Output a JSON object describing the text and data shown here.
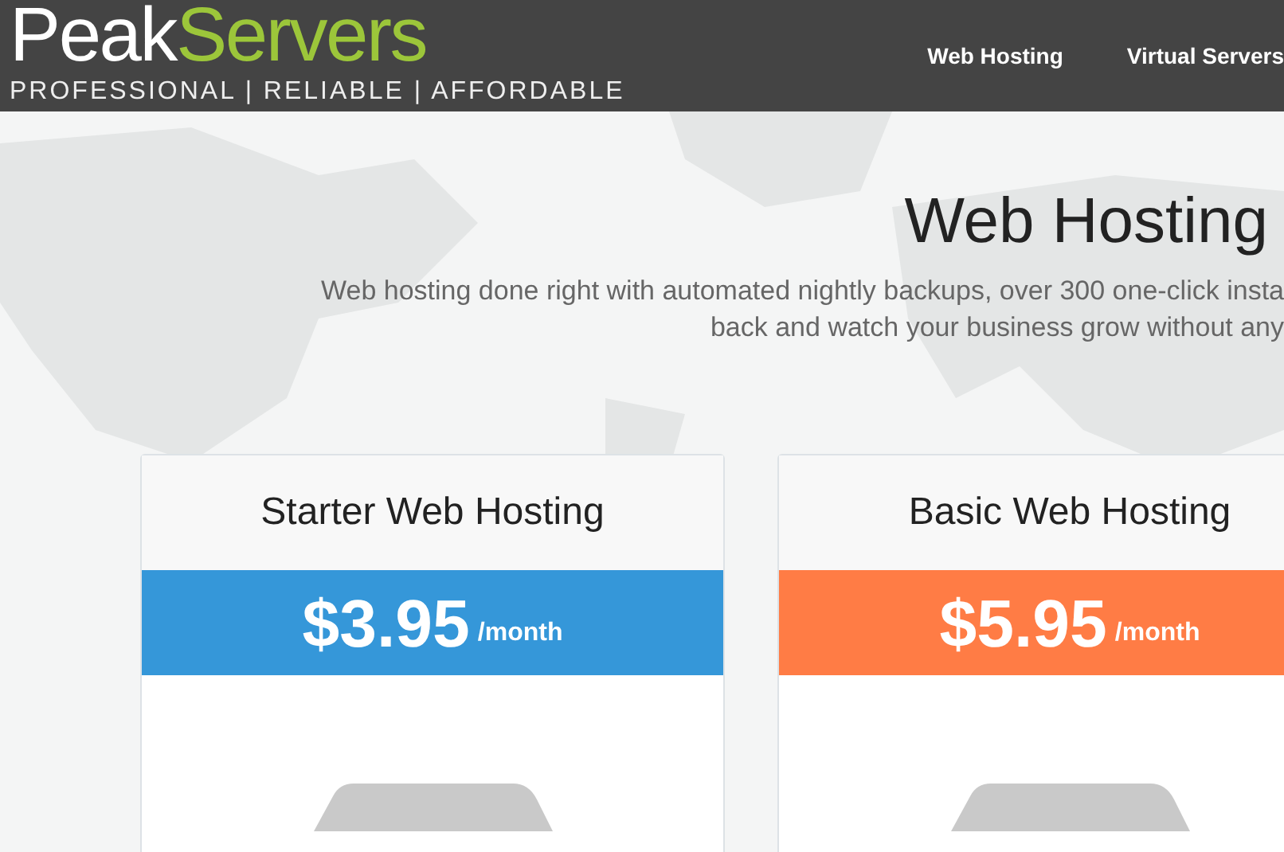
{
  "header": {
    "logo": {
      "first": "Peak",
      "second": "Servers",
      "tagline": "PROFESSIONAL | RELIABLE | AFFORDABLE"
    },
    "nav": [
      {
        "label": "Web Hosting"
      },
      {
        "label": "Virtual Servers"
      }
    ]
  },
  "hero": {
    "title": "Web Hosting",
    "lines": [
      "Web hosting done right with automated nightly backups, over 300 one-click insta",
      "back and watch your business grow without any"
    ]
  },
  "plans": [
    {
      "name": "Starter Web Hosting",
      "price": "$3.95",
      "period": "/month",
      "color": "#3597d9"
    },
    {
      "name": "Basic Web Hosting",
      "price": "$5.95",
      "period": "/month",
      "color": "#ff7c45"
    }
  ]
}
